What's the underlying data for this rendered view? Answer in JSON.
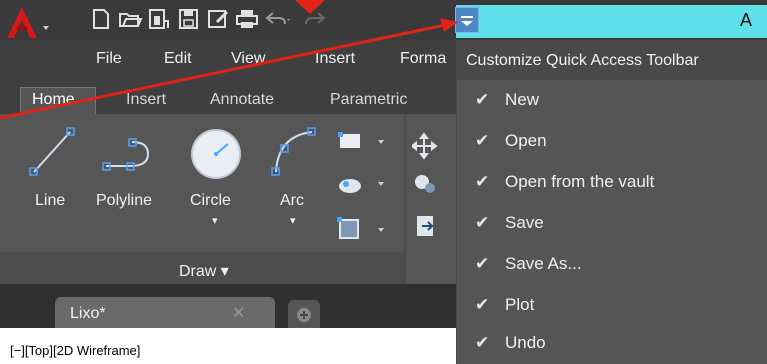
{
  "title_bar": {
    "title_partial": "A"
  },
  "menubar": {
    "items": [
      "File",
      "Edit",
      "View",
      "Insert",
      "Forma"
    ]
  },
  "ribbon": {
    "tabs": [
      "Home",
      "Insert",
      "Annotate",
      "Parametric"
    ],
    "draw_tools": [
      "Line",
      "Polyline",
      "Circle",
      "Arc"
    ],
    "draw_panel_label": "Draw ▾"
  },
  "file_tabs": {
    "current": "Lixo*"
  },
  "viewport": {
    "label": "[−][Top][2D Wireframe]"
  },
  "qat_menu": {
    "title": "Customize Quick Access Toolbar",
    "items": [
      {
        "label": "New",
        "checked": "✔"
      },
      {
        "label": "Open",
        "checked": "✔"
      },
      {
        "label": "Open from the vault",
        "checked": "✔"
      },
      {
        "label": "Save",
        "checked": "✔"
      },
      {
        "label": "Save As...",
        "checked": "✔"
      },
      {
        "label": "Plot",
        "checked": "✔"
      },
      {
        "label": "Undo",
        "checked": "✔"
      }
    ]
  },
  "colors": {
    "accent_cyan": "#5ee0ea",
    "annotation_red": "#e2231a",
    "menu_bg": "#555555"
  }
}
